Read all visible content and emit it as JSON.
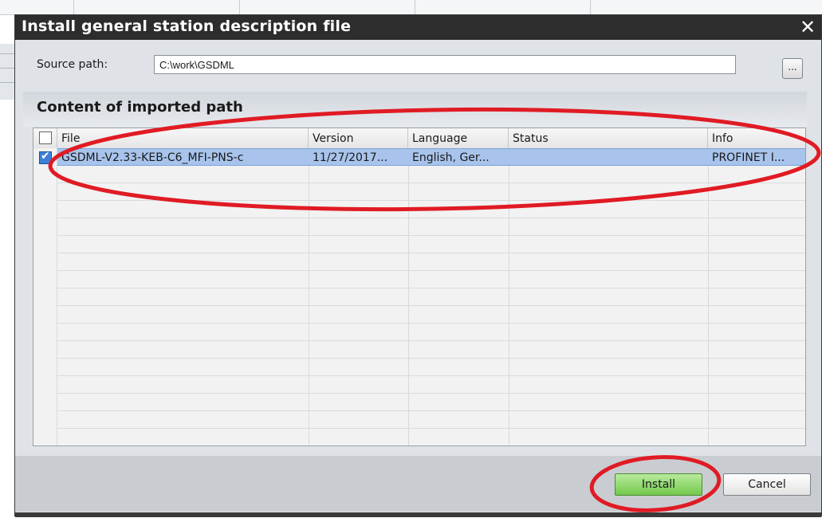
{
  "dialog": {
    "title": "Install general station description file",
    "close_glyph": "✕"
  },
  "source": {
    "label": "Source path:",
    "value": "C:\\work\\GSDML",
    "browse_label": "..."
  },
  "content": {
    "heading": "Content of imported path"
  },
  "table": {
    "columns": [
      "File",
      "Version",
      "Language",
      "Status",
      "Info"
    ],
    "rows": [
      {
        "checked": true,
        "file": "GSDML-V2.33-KEB-C6_MFI-PNS-c",
        "version": "11/27/2017...",
        "language": "English, Ger...",
        "status": "",
        "info": "PROFINET I..."
      }
    ]
  },
  "buttons": {
    "install": "Install",
    "cancel": "Cancel"
  },
  "colors": {
    "titlebar": "#2d2d2d",
    "selection": "#a8c4ec",
    "install_button": "#73c94d",
    "annotation": "#e01b24"
  },
  "icons": {
    "close": "close-icon",
    "header_checkbox": "checkbox-icon",
    "row_checkbox": "checkbox-checked-icon"
  }
}
